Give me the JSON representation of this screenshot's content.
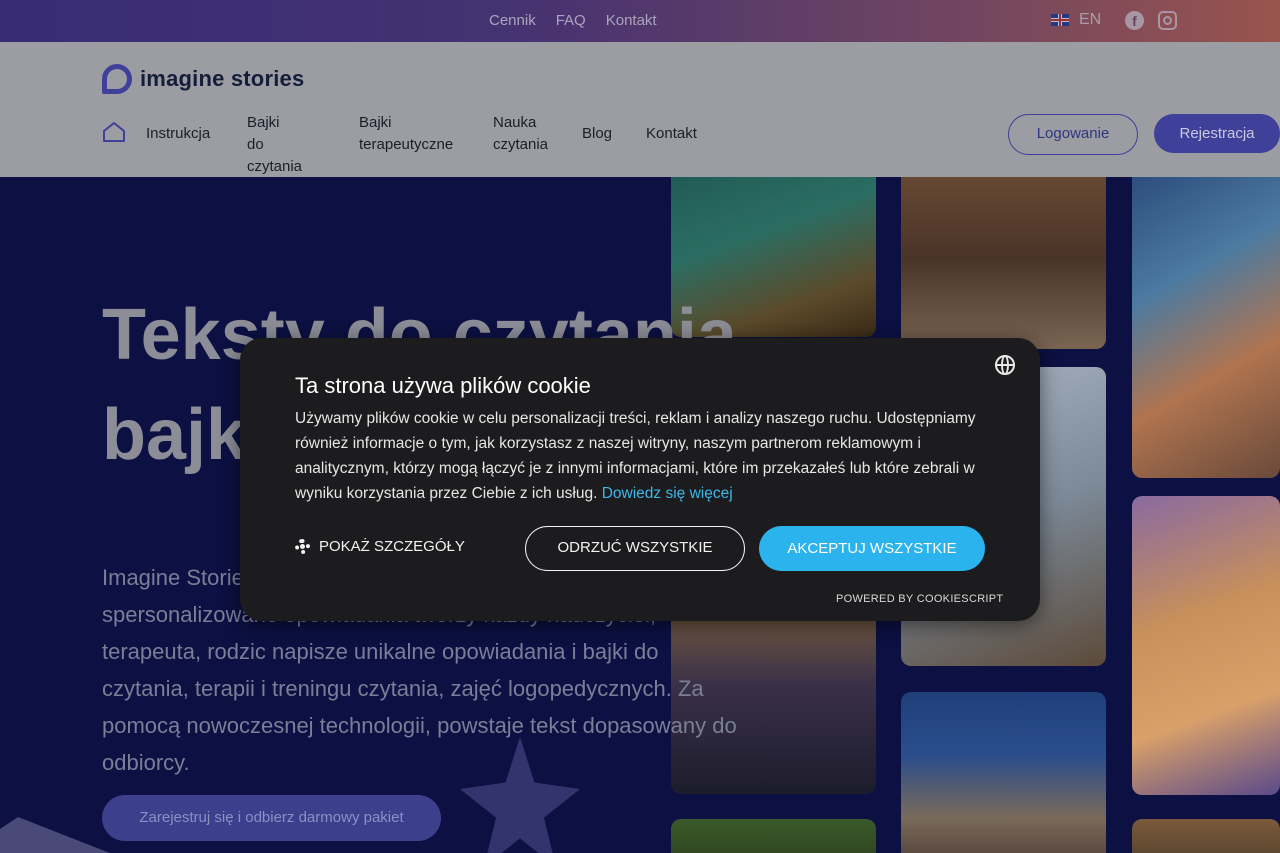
{
  "topbar": {
    "links": [
      "Cennik",
      "FAQ",
      "Kontakt"
    ],
    "lang": "EN"
  },
  "header": {
    "logo_text": "imagine stories",
    "nav": [
      {
        "label": "Instrukcja"
      },
      {
        "label": "Bajki\ndo czytania"
      },
      {
        "label": "Bajki\nterapeutyczne"
      },
      {
        "label": "Nauka\nczytania"
      },
      {
        "label": "Blog"
      },
      {
        "label": "Kontakt"
      }
    ],
    "login": "Logowanie",
    "register": "Rejestracja"
  },
  "hero": {
    "title": "Teksty do czytania bajki dla dzieci",
    "description": "Imagine Stories to narzędzie AI, dzięki któremu w kilka minut spersonalizowane opowiadania tworzy każdy nauczyciel, terapeuta, rodzic napisze unikalne opowiadania i bajki do czytania, terapii i treningu czytania, zajęć logopedycznych. Za pomocą nowoczesnej technologii, powstaje tekst dopasowany do odbiorcy.",
    "cta": "Zarejestruj się i odbierz darmowy pakiet"
  },
  "cookie": {
    "title": "Ta strona używa plików cookie",
    "body": "Używamy plików cookie w celu personalizacji treści, reklam i analizy naszego ruchu. Udostępniamy również informacje o tym, jak korzystasz z naszej witryny, naszym partnerom reklamowym i analitycznym, którzy mogą łączyć je z innymi informacjami, które im przekazałeś lub które zebrali w wyniku korzystania przez Ciebie z ich usług.",
    "more_link": "Dowiedz się więcej",
    "details": "POKAŻ SZCZEGÓŁY",
    "reject": "ODRZUĆ WSZYSTKIE",
    "accept": "AKCEPTUJ WSZYSTKIE",
    "powered": "POWERED BY COOKIESCRIPT"
  },
  "colors": {
    "brand": "#3e4099",
    "accept": "#2ab3ec",
    "modal_bg": "#1c1c1e",
    "hero_bg": "#0c1042"
  }
}
